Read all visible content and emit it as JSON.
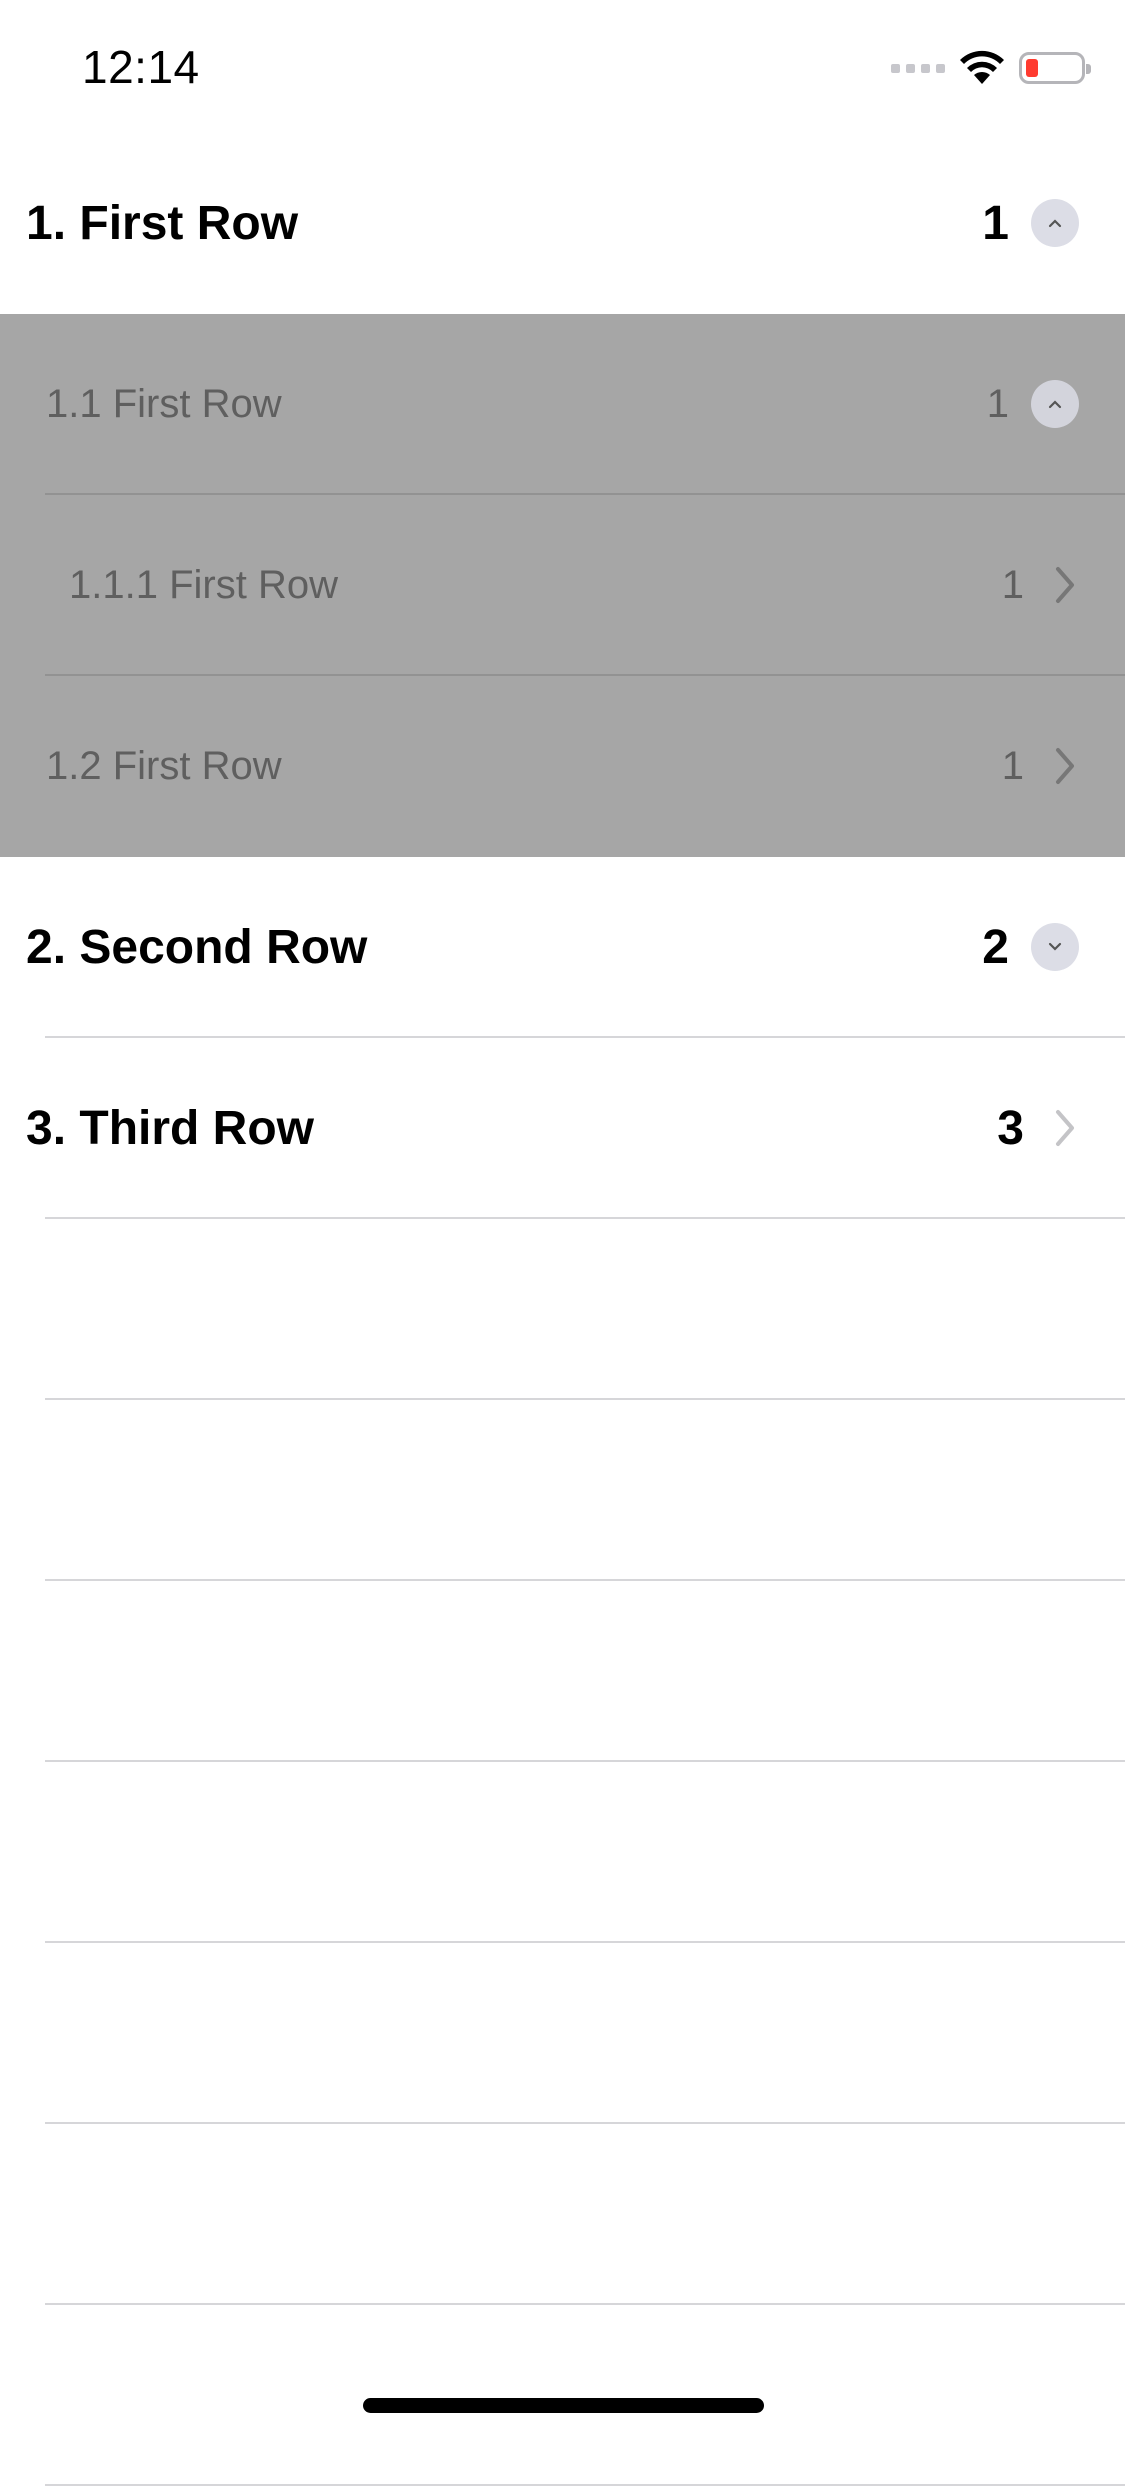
{
  "status_bar": {
    "time": "12:14",
    "icons": [
      "signal-dots-icon",
      "wifi-icon",
      "battery-low-icon"
    ],
    "battery_color": "#ff3b30"
  },
  "rows": [
    {
      "title": "1. First Row",
      "count": "1",
      "accessory": "collapse-circle-icon"
    },
    {
      "title": "1.1 First Row",
      "count": "1",
      "accessory": "collapse-circle-icon"
    },
    {
      "title": "1.1.1 First Row",
      "count": "1",
      "accessory": "chevron-right-icon"
    },
    {
      "title": "1.2 First Row",
      "count": "1",
      "accessory": "chevron-right-icon"
    },
    {
      "title": "2. Second Row",
      "count": "2",
      "accessory": "expand-circle-icon"
    },
    {
      "title": "3. Third Row",
      "count": "3",
      "accessory": "chevron-right-icon"
    }
  ],
  "colors": {
    "expanded_section_bg": "#a6a6a6",
    "separator": "#d6d6d9"
  }
}
